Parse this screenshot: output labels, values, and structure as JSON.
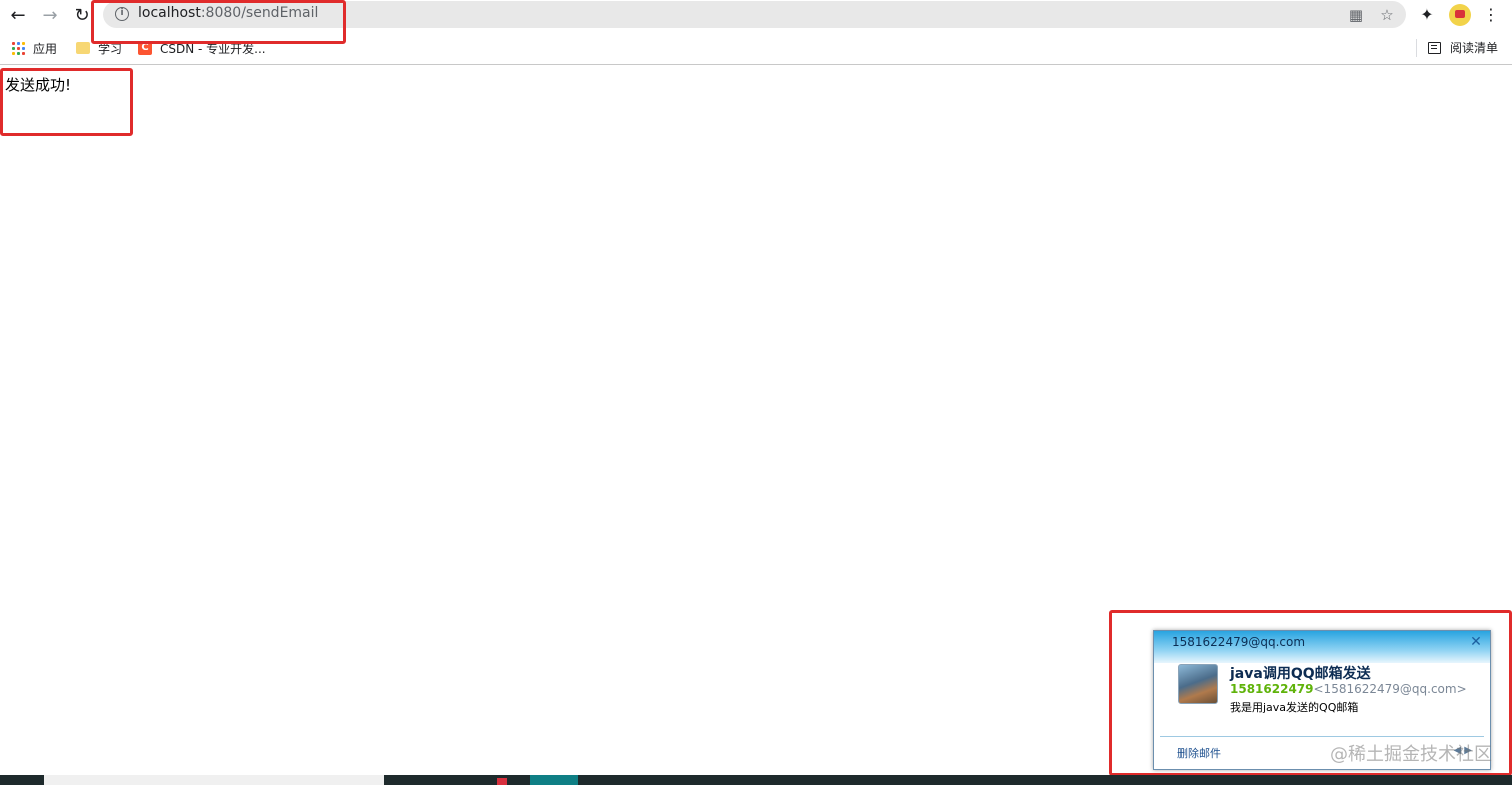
{
  "browser": {
    "url_host": "localhost",
    "url_path": ":8080/sendEmail"
  },
  "bookmarks": {
    "apps_label": "应用",
    "folder_label": "学习",
    "csdn_label": "CSDN - 专业开发...",
    "reading_list_label": "阅读清单"
  },
  "page": {
    "message": "发送成功!"
  },
  "notification": {
    "recipient": "1581622479@qq.com",
    "subject": "java调用QQ邮箱发送",
    "sender_name": "1581622479",
    "sender_address": "<1581622479@qq.com>",
    "body": "我是用java发送的QQ邮箱",
    "delete_label": "删除邮件"
  },
  "watermark": "@稀土掘金技术社区",
  "colors": {
    "annotation": "#e02b2b",
    "sender_name": "#5fb30a",
    "header_blue": "#28a4e0"
  }
}
